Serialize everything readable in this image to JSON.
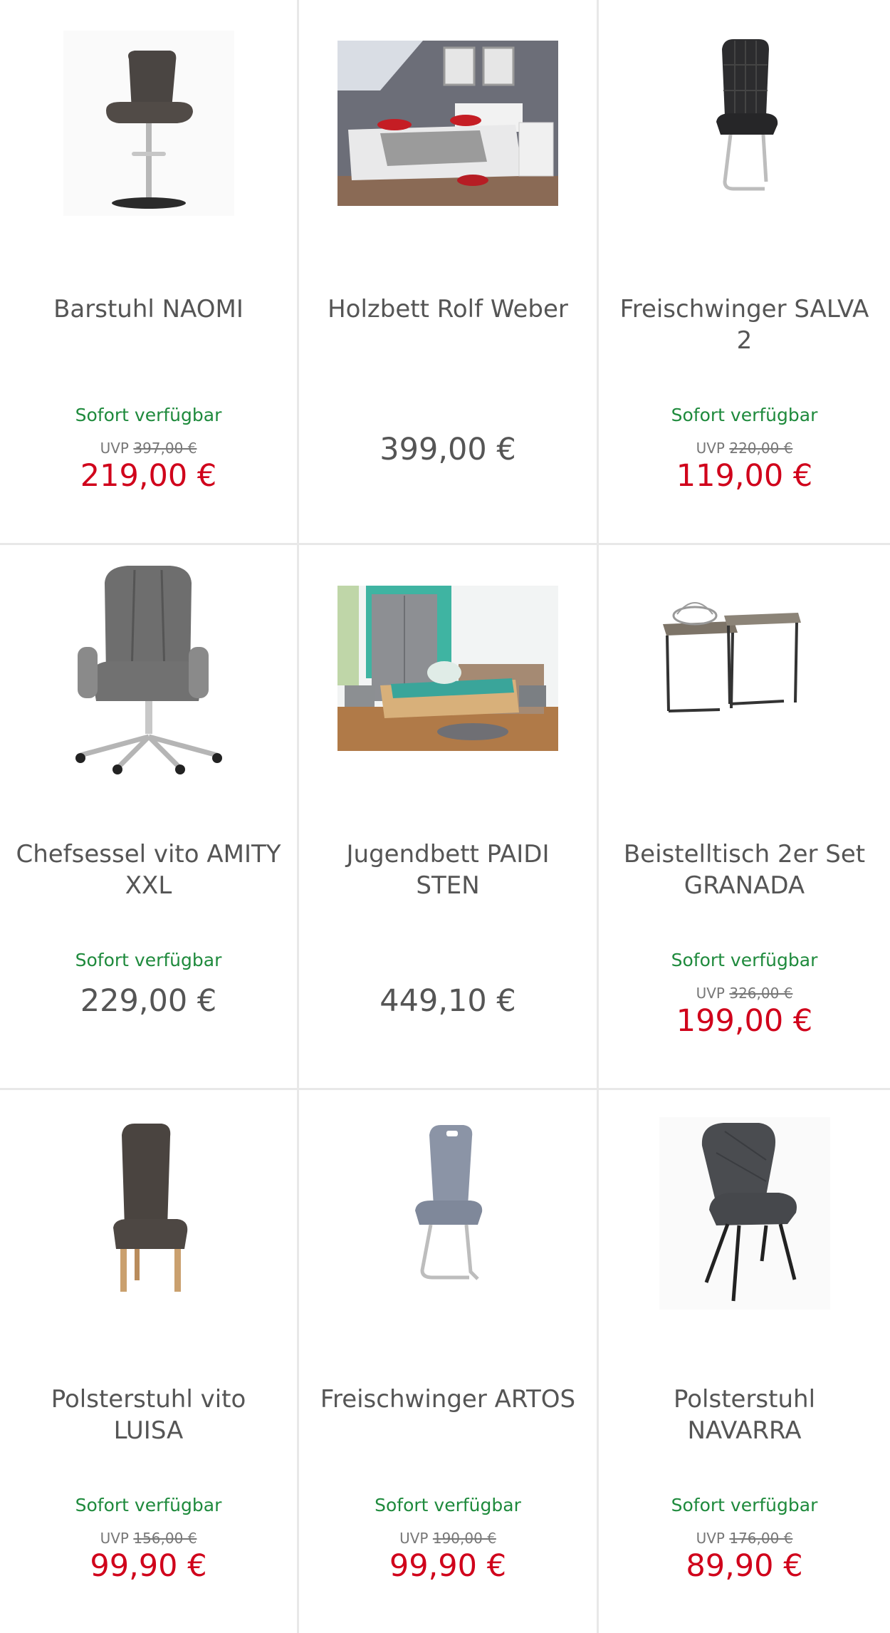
{
  "colors": {
    "availability": "#1e8a3c",
    "sale_price": "#d0021b",
    "regular_price": "#555555",
    "title": "#555555",
    "divider": "#e8e8e8"
  },
  "products": [
    {
      "title": "Barstuhl NAOMI",
      "availability": "Sofort verfügbar",
      "uvp_label": "UVP",
      "uvp_price": "397,00 €",
      "price": "219,00 €",
      "image_icon": "bar-stool-image"
    },
    {
      "title": "Holzbett Rolf Weber",
      "availability": "",
      "uvp_label": "",
      "uvp_price": "",
      "price": "399,00 €",
      "image_icon": "wooden-bed-image"
    },
    {
      "title": "Freischwinger SALVA 2",
      "availability": "Sofort verfügbar",
      "uvp_label": "UVP",
      "uvp_price": "220,00 €",
      "price": "119,00 €",
      "image_icon": "cantilever-chair-image"
    },
    {
      "title": "Chefsessel vito AMITY XXL",
      "availability": "Sofort verfügbar",
      "uvp_label": "",
      "uvp_price": "",
      "price": "229,00 €",
      "image_icon": "office-chair-image"
    },
    {
      "title": "Jugendbett PAIDI STEN",
      "availability": "",
      "uvp_label": "",
      "uvp_price": "",
      "price": "449,10 €",
      "image_icon": "youth-bed-image"
    },
    {
      "title": "Beistelltisch 2er Set GRANADA",
      "availability": "Sofort verfügbar",
      "uvp_label": "UVP",
      "uvp_price": "326,00 €",
      "price": "199,00 €",
      "image_icon": "side-table-set-image"
    },
    {
      "title": "Polsterstuhl vito LUISA",
      "availability": "Sofort verfügbar",
      "uvp_label": "UVP",
      "uvp_price": "156,00 €",
      "price": "99,90 €",
      "image_icon": "upholstered-chair-image"
    },
    {
      "title": "Freischwinger ARTOS",
      "availability": "Sofort verfügbar",
      "uvp_label": "UVP",
      "uvp_price": "190,00 €",
      "price": "99,90 €",
      "image_icon": "cantilever-chair-grey-image"
    },
    {
      "title": "Polsterstuhl NAVARRA",
      "availability": "Sofort verfügbar",
      "uvp_label": "UVP",
      "uvp_price": "176,00 €",
      "price": "89,90 €",
      "image_icon": "dining-chair-image"
    }
  ]
}
